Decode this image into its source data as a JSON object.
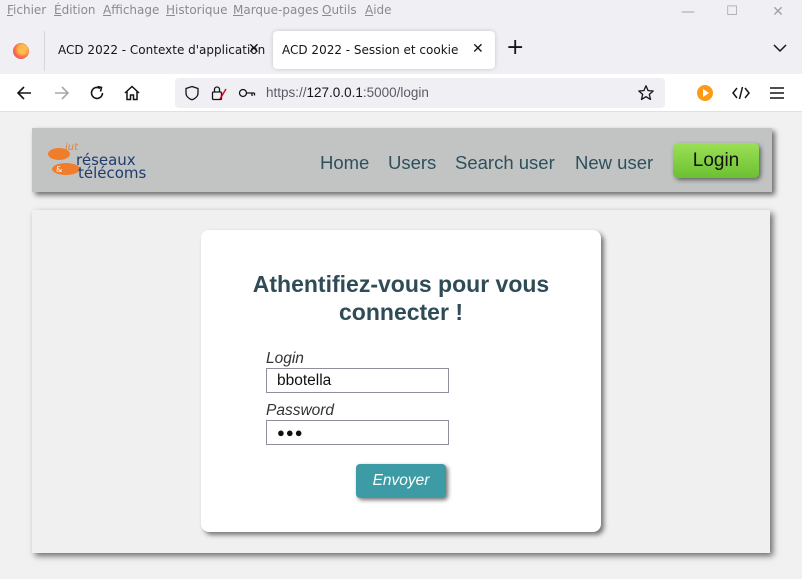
{
  "menubar": {
    "items": [
      "Fichier",
      "Édition",
      "Affichage",
      "Historique",
      "Marque-pages",
      "Outils",
      "Aide"
    ]
  },
  "window_controls": {
    "minimize": "—",
    "maximize": "☐",
    "close": "✕"
  },
  "tabs": [
    {
      "title": "ACD 2022 - Contexte d'application",
      "active": false
    },
    {
      "title": "ACD 2022 - Session et cookie",
      "active": true
    }
  ],
  "tab_close_glyph": "✕",
  "new_tab_glyph": "+",
  "urlbar": {
    "scheme": "https://",
    "host": "127.0.0.1",
    "rest": ":5000/login"
  },
  "site": {
    "logo": {
      "small": "iut",
      "line1": "réseaux",
      "line2": "télécoms",
      "amp": "&"
    },
    "nav": [
      "Home",
      "Users",
      "Search user",
      "New user"
    ],
    "login_button": "Login"
  },
  "form": {
    "title": "Athentifiez-vous pour vous connecter !",
    "login_label": "Login",
    "login_value": "bbotella",
    "password_label": "Password",
    "password_value": "●●●",
    "submit_label": "Envoyer"
  },
  "colors": {
    "accent_green": "#7ccd3f",
    "accent_teal": "#3d9ba6",
    "header_gray": "#c2c4c4",
    "title_text": "#2e4b56",
    "logo_orange": "#f07d2c",
    "logo_blue": "#1f3b6e"
  },
  "icons": [
    "firefox-icon",
    "back-arrow-icon",
    "forward-arrow-icon",
    "reload-icon",
    "home-icon",
    "shield-icon",
    "lock-icon",
    "key-icon",
    "star-icon",
    "play-extension-icon",
    "code-icon",
    "hamburger-menu-icon",
    "chevron-down-icon"
  ]
}
